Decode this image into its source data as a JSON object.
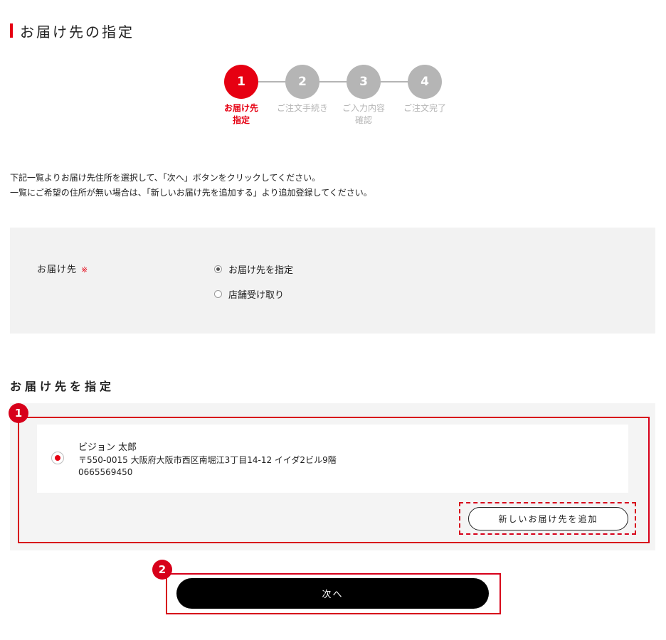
{
  "page": {
    "title": "お届け先の指定",
    "instructions": [
      "下記一覧よりお届け先住所を選択して、「次へ」ボタンをクリックしてください。",
      "一覧にご希望の住所が無い場合は、「新しいお届け先を追加する」より追加登録してください。"
    ]
  },
  "steps": [
    {
      "number": "1",
      "label_line1": "お届け先",
      "label_line2": "指定",
      "state": "active"
    },
    {
      "number": "2",
      "label_line1": "ご注文手続き",
      "label_line2": "",
      "state": "inactive"
    },
    {
      "number": "3",
      "label_line1": "ご入力内容",
      "label_line2": "確認",
      "state": "inactive"
    },
    {
      "number": "4",
      "label_line1": "ご注文完了",
      "label_line2": "",
      "state": "inactive"
    }
  ],
  "delivery": {
    "label": "お届け先",
    "required_mark": "※",
    "options": [
      {
        "label": "お届け先を指定",
        "selected": true
      },
      {
        "label": "店舗受け取り",
        "selected": false
      }
    ]
  },
  "address_section": {
    "heading": "お届け先を指定",
    "addresses": [
      {
        "name": "ビジョン 太郎",
        "address": "〒550-0015 大阪府大阪市西区南堀江3丁目14-12 イイダ2ビル9階",
        "phone": "0665569450",
        "selected": true
      }
    ],
    "add_button_label": "新しいお届け先を追加"
  },
  "next_button_label": "次へ",
  "annotations": {
    "badge1": "1",
    "badge2": "2"
  },
  "colors": {
    "accent": "#e60012",
    "inactive": "#b5b5b5",
    "panel": "#f2f2f2",
    "annotation": "#d7001a"
  }
}
